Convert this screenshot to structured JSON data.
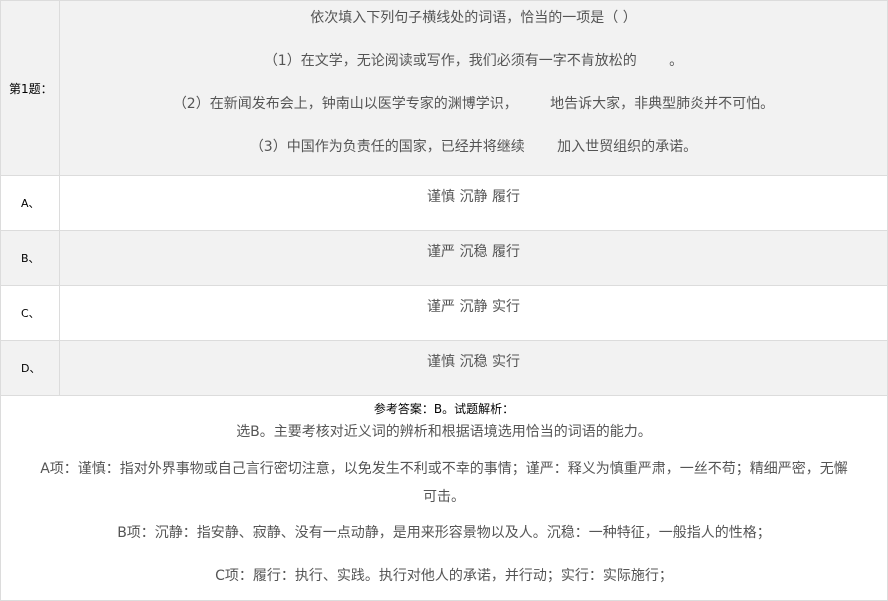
{
  "question": {
    "number_label": "第1题：",
    "prompt": "依次填入下列句子横线处的词语，恰当的一项是（    ）",
    "sentences": [
      "（1）在文学，无论阅读或写作，我们必须有一字不肯放松的 　　。",
      "（2）在新闻发布会上，钟南山以医学专家的渊博学识， 　　地告诉大家，非典型肺炎并不可怕。",
      "（3）中国作为负责任的国家，已经并将继续 　　加入世贸组织的承诺。"
    ]
  },
  "options": [
    {
      "label": "A、",
      "text": "谨慎  沉静  履行"
    },
    {
      "label": "B、",
      "text": "谨严  沉稳  履行"
    },
    {
      "label": "C、",
      "text": "谨严  沉静  实行"
    },
    {
      "label": "D、",
      "text": "谨慎  沉稳  实行"
    }
  ],
  "answer": {
    "heading": "参考答案：B。试题解析：",
    "paragraphs": [
      "选B。主要考核对近义词的辨析和根据语境选用恰当的词语的能力。",
      "A项：谨慎：指对外界事物或自己言行密切注意，以免发生不利或不幸的事情；谨严：释义为慎重严肃，一丝不苟；精细严密，无懈",
      "可击。",
      "B项：沉静：指安静、寂静、没有一点动静，是用来形容景物以及人。沉稳：一种特征，一般指人的性格；",
      "C项：履行：执行、实践。执行对他人的承诺，并行动；实行：实际施行；"
    ]
  }
}
